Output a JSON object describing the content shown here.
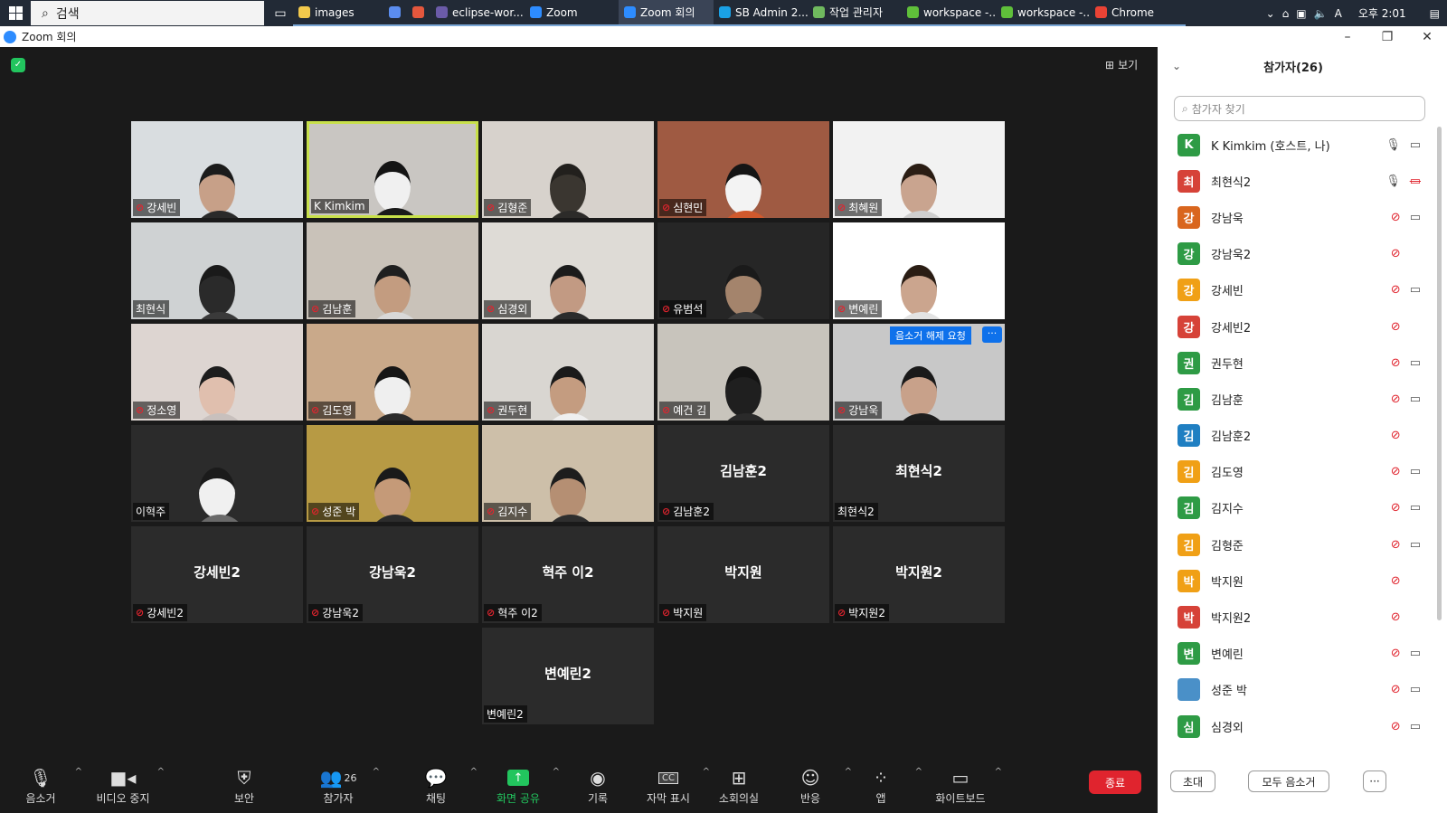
{
  "taskbar": {
    "search_label": "검색",
    "apps": [
      {
        "label": "images",
        "color": "#f2c94c"
      },
      {
        "label": "",
        "color": "#5b8def"
      },
      {
        "label": "",
        "color": "#e4573d"
      },
      {
        "label": "eclipse-wor...",
        "color": "#6b5ba8"
      },
      {
        "label": "Zoom",
        "color": "#2d8cff"
      },
      {
        "label": "Zoom 회의",
        "color": "#2d8cff"
      },
      {
        "label": "SB Admin 2...",
        "color": "#1aa1e6"
      },
      {
        "label": "작업 관리자",
        "color": "#6fb95e"
      },
      {
        "label": "workspace -...",
        "color": "#5fbf3a"
      },
      {
        "label": "workspace -...",
        "color": "#5fbf3a"
      },
      {
        "label": "Chrome",
        "color": "#ea4335"
      }
    ],
    "tray_ime": "A",
    "clock": "오후 2:01"
  },
  "window": {
    "title": "Zoom 회의"
  },
  "gallery": {
    "view_label": "보기",
    "unmute_request_label": "음소거 해제 요청",
    "tiles": [
      {
        "name": "강세빈",
        "muted": true,
        "video": true,
        "bg": "#d9dde0",
        "skin": "#c7a088",
        "cloth": "#2a2a2a",
        "hair": "#1b1b1b"
      },
      {
        "name": "K Kimkim",
        "muted": false,
        "video": true,
        "active": true,
        "bg": "#c9c6c2",
        "skin": "#f0f0f0",
        "cloth": "#1a1a1a",
        "hair": "#141414"
      },
      {
        "name": "김형준",
        "muted": true,
        "video": true,
        "bg": "#d7d2cc",
        "skin": "#3a3630",
        "cloth": "#2c2b29",
        "hair": "#22201d"
      },
      {
        "name": "심현민",
        "muted": true,
        "video": true,
        "bg": "#9f5a42",
        "skin": "#f3f3f3",
        "cloth": "#d0592d",
        "hair": "#151515"
      },
      {
        "name": "최혜원",
        "muted": true,
        "video": true,
        "bg": "#f2f2f2",
        "skin": "#c9a48f",
        "cloth": "#cfcfcf",
        "hair": "#2a1d14"
      },
      {
        "name": "최현식",
        "muted": false,
        "video": true,
        "bg": "#cfd2d3",
        "skin": "#2a2a2a",
        "cloth": "#3a3a3a",
        "hair": "#1a1a1a"
      },
      {
        "name": "김남훈",
        "muted": true,
        "video": true,
        "bg": "#c9c2b9",
        "skin": "#c39c80",
        "cloth": "#d8d8d8",
        "hair": "#1f1f1f"
      },
      {
        "name": "심경외",
        "muted": true,
        "video": true,
        "bg": "#dedbd6",
        "skin": "#c29a83",
        "cloth": "#2c2c2c",
        "hair": "#1b1b1b"
      },
      {
        "name": "유범석",
        "muted": true,
        "video": true,
        "bg": "#262626",
        "skin": "#a4846c",
        "cloth": "#3c3c3c",
        "hair": "#1a1a1a"
      },
      {
        "name": "변예린",
        "muted": true,
        "video": true,
        "bg": "#ffffff",
        "skin": "#cba58e",
        "cloth": "#e3e3e3",
        "hair": "#2a1d14"
      },
      {
        "name": "정소영",
        "muted": true,
        "video": true,
        "bg": "#ddd5d1",
        "skin": "#e0bfae",
        "cloth": "#c8c0bd",
        "hair": "#1d1d1d"
      },
      {
        "name": "김도영",
        "muted": true,
        "video": true,
        "bg": "#c9a98a",
        "skin": "#efefef",
        "cloth": "#2a2a2a",
        "hair": "#161616"
      },
      {
        "name": "권두현",
        "muted": true,
        "video": true,
        "bg": "#d9d6d1",
        "skin": "#c49c80",
        "cloth": "#efefef",
        "hair": "#1a1a1a"
      },
      {
        "name": "예건 김",
        "muted": true,
        "video": true,
        "bg": "#c8c4bc",
        "skin": "#1f1f1f",
        "cloth": "#2a2a2a",
        "hair": "#141414"
      },
      {
        "name": "강남욱",
        "muted": true,
        "video": true,
        "bg": "#c8c8c8",
        "skin": "#c8a18a",
        "cloth": "#1e1e1e",
        "hair": "#1a1a1a",
        "hover": true
      },
      {
        "name": "이혁주",
        "muted": false,
        "video": true,
        "bg": "#2b2b2b",
        "skin": "#f0f0f0",
        "cloth": "#6a6a6a",
        "hair": "#1b1b1b"
      },
      {
        "name": "성준 박",
        "muted": true,
        "video": true,
        "bg": "#b79a44",
        "skin": "#c59a78",
        "cloth": "#2c2c2c",
        "hair": "#1a1a1a"
      },
      {
        "name": "김지수",
        "muted": true,
        "video": true,
        "bg": "#cdbfa9",
        "skin": "#b58f73",
        "cloth": "#2e2e2e",
        "hair": "#1d1d1d"
      },
      {
        "name": "김남훈2",
        "muted": true,
        "video": false
      },
      {
        "name": "최현식2",
        "muted": false,
        "video": false
      },
      {
        "name": "강세빈2",
        "muted": true,
        "video": false
      },
      {
        "name": "강남욱2",
        "muted": true,
        "video": false
      },
      {
        "name": "혁주 이2",
        "muted": true,
        "video": false
      },
      {
        "name": "박지원",
        "muted": true,
        "video": false
      },
      {
        "name": "박지원2",
        "muted": true,
        "video": false
      },
      {
        "name": "변예린2",
        "muted": false,
        "video": false
      }
    ]
  },
  "toolbar": {
    "mute_label": "음소거",
    "video_label": "비디오 중지",
    "security_label": "보안",
    "participants_label": "참가자",
    "participants_count": "26",
    "chat_label": "채팅",
    "share_label": "화면 공유",
    "record_label": "기록",
    "captions_label": "자막 표시",
    "breakout_label": "소회의실",
    "reactions_label": "반응",
    "apps_label": "앱",
    "whiteboard_label": "화이트보드",
    "end_label": "종료"
  },
  "panel": {
    "title": "참가자(26)",
    "search_placeholder": "참가자 찾기",
    "participants": [
      {
        "initial": "K",
        "name": "K Kimkim (호스트, 나)",
        "color": "#2e9b45",
        "mic": "on",
        "video": "on"
      },
      {
        "initial": "최",
        "name": "최현식2",
        "color": "#d64238",
        "mic": "on",
        "video": "off"
      },
      {
        "initial": "강",
        "name": "강남욱",
        "color": "#d9661e",
        "mic": "muted",
        "video": "on"
      },
      {
        "initial": "강",
        "name": "강남욱2",
        "color": "#2e9b45",
        "mic": "muted",
        "video": "none"
      },
      {
        "initial": "강",
        "name": "강세빈",
        "color": "#f0a016",
        "mic": "muted",
        "video": "on"
      },
      {
        "initial": "강",
        "name": "강세빈2",
        "color": "#d64238",
        "mic": "muted",
        "video": "none"
      },
      {
        "initial": "권",
        "name": "권두현",
        "color": "#2e9b45",
        "mic": "muted",
        "video": "on"
      },
      {
        "initial": "김",
        "name": "김남훈",
        "color": "#2e9b45",
        "mic": "muted",
        "video": "on"
      },
      {
        "initial": "김",
        "name": "김남훈2",
        "color": "#1f7fc2",
        "mic": "muted",
        "video": "none"
      },
      {
        "initial": "김",
        "name": "김도영",
        "color": "#f0a016",
        "mic": "muted",
        "video": "on"
      },
      {
        "initial": "김",
        "name": "김지수",
        "color": "#2e9b45",
        "mic": "muted",
        "video": "on"
      },
      {
        "initial": "김",
        "name": "김형준",
        "color": "#f0a016",
        "mic": "muted",
        "video": "on"
      },
      {
        "initial": "박",
        "name": "박지원",
        "color": "#f0a016",
        "mic": "muted",
        "video": "none"
      },
      {
        "initial": "박",
        "name": "박지원2",
        "color": "#d64238",
        "mic": "muted",
        "video": "none"
      },
      {
        "initial": "변",
        "name": "변예린",
        "color": "#2e9b45",
        "mic": "muted",
        "video": "on"
      },
      {
        "initial": "",
        "name": "성준 박",
        "color": "#4a90c8",
        "mic": "muted",
        "video": "on"
      },
      {
        "initial": "심",
        "name": "심경외",
        "color": "#2e9b45",
        "mic": "muted",
        "video": "on"
      }
    ],
    "invite_label": "초대",
    "mute_all_label": "모두 음소거",
    "more_label": "···"
  }
}
